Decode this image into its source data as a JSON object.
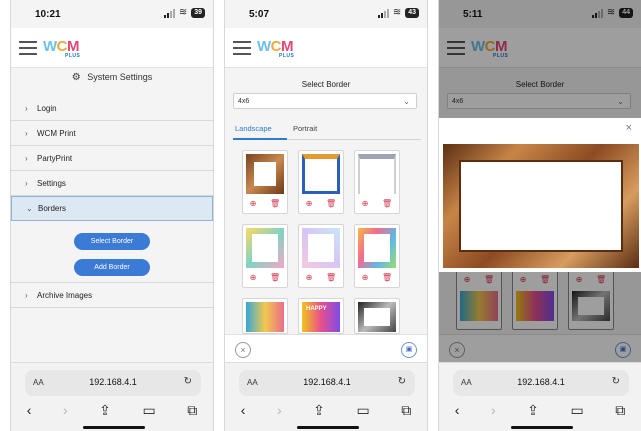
{
  "phone1": {
    "time": "10:21",
    "battery": "39",
    "logo": {
      "w": "W",
      "c": "C",
      "m": "M",
      "plus": "PLUS"
    },
    "settings_title": "System Settings",
    "nav": [
      {
        "label": "Login"
      },
      {
        "label": "WCM Print"
      },
      {
        "label": "PartyPrint"
      },
      {
        "label": "Settings"
      },
      {
        "label": "Borders"
      },
      {
        "label": "Archive Images"
      }
    ],
    "borders_actions": {
      "select": "Select Border",
      "add": "Add Border"
    },
    "url": "192.168.4.1",
    "aa": "AA"
  },
  "phone2": {
    "time": "5:07",
    "battery": "43",
    "logo": {
      "w": "W",
      "c": "C",
      "m": "M",
      "plus": "PLUS"
    },
    "select_title": "Select Border",
    "size": "4x6",
    "tabs": [
      "Landscape",
      "Portrait"
    ],
    "happy_label": "HAPPY",
    "url": "192.168.4.1",
    "aa": "AA"
  },
  "phone3": {
    "time": "5:11",
    "battery": "44",
    "logo": {
      "w": "W",
      "c": "C",
      "m": "M",
      "plus": "PLUS"
    },
    "select_title": "Select Border",
    "size": "4x6",
    "url": "192.168.4.1",
    "aa": "AA"
  },
  "icons": {
    "close": "×",
    "chevron_right": "›",
    "chevron_down": "⌄",
    "reload": "↻",
    "back": "‹",
    "forward": "›",
    "share": "⇪",
    "bookmarks": "▭",
    "tabs": "⧉"
  }
}
